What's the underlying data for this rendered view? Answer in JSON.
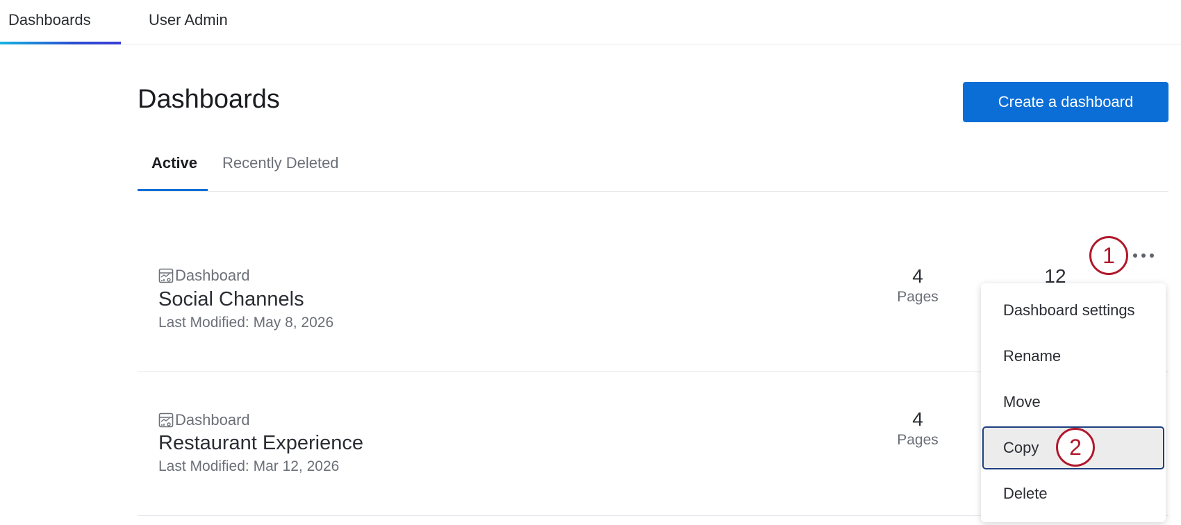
{
  "topnav": {
    "tabs": [
      {
        "label": "Dashboards",
        "active": true
      },
      {
        "label": "User Admin",
        "active": false
      }
    ]
  },
  "header": {
    "title": "Dashboards",
    "create_button": "Create a dashboard"
  },
  "subtabs": [
    {
      "label": "Active",
      "active": true
    },
    {
      "label": "Recently Deleted",
      "active": false
    }
  ],
  "dashboards": [
    {
      "type": "Dashboard",
      "name": "Social Channels",
      "modified": "Last Modified: May 8, 2026",
      "pages": "4",
      "pages_label": "Pages",
      "second_count": "12"
    },
    {
      "type": "Dashboard",
      "name": "Restaurant Experience",
      "modified": "Last Modified: Mar 12, 2026",
      "pages": "4",
      "pages_label": "Pages"
    }
  ],
  "menu": {
    "items": [
      {
        "label": "Dashboard settings"
      },
      {
        "label": "Rename"
      },
      {
        "label": "Move"
      },
      {
        "label": "Copy",
        "highlighted": true
      },
      {
        "label": "Delete"
      }
    ]
  },
  "callouts": [
    "1",
    "2"
  ],
  "colors": {
    "primary": "#0b6ed6",
    "callout": "#b0182b",
    "highlight_border": "#1d3f80"
  }
}
